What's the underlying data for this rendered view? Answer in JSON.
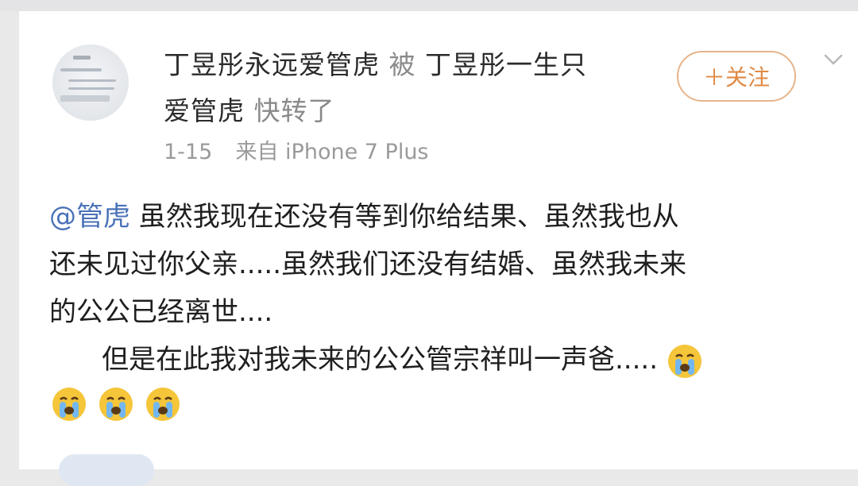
{
  "post": {
    "author_line1": "丁昱彤永远爱管虎",
    "connector": "被",
    "retweeter_line1": "丁昱彤一生只",
    "retweeter_line2": "爱管虎",
    "action": "快转了",
    "date": "1-15",
    "source": "来自 iPhone 7 Plus",
    "follow_label": "＋关注",
    "body": {
      "mention": "@管虎",
      "line1_text": " 虽然我现在还没有等到你给结果、虽然我也从",
      "line2": "还未见过你父亲.....虽然我们还没有结婚、虽然我未来",
      "line3": "的公公已经离世....",
      "line4": "但是在此我对我未来的公公管宗祥叫一声爸....."
    }
  },
  "icons": {
    "chevron": "chevron-down-icon",
    "emoji": "crying-face-emoji"
  },
  "colors": {
    "follow_accent": "#e08a45",
    "mention": "#4a72b8",
    "emoji_face": "#f5c53a"
  }
}
